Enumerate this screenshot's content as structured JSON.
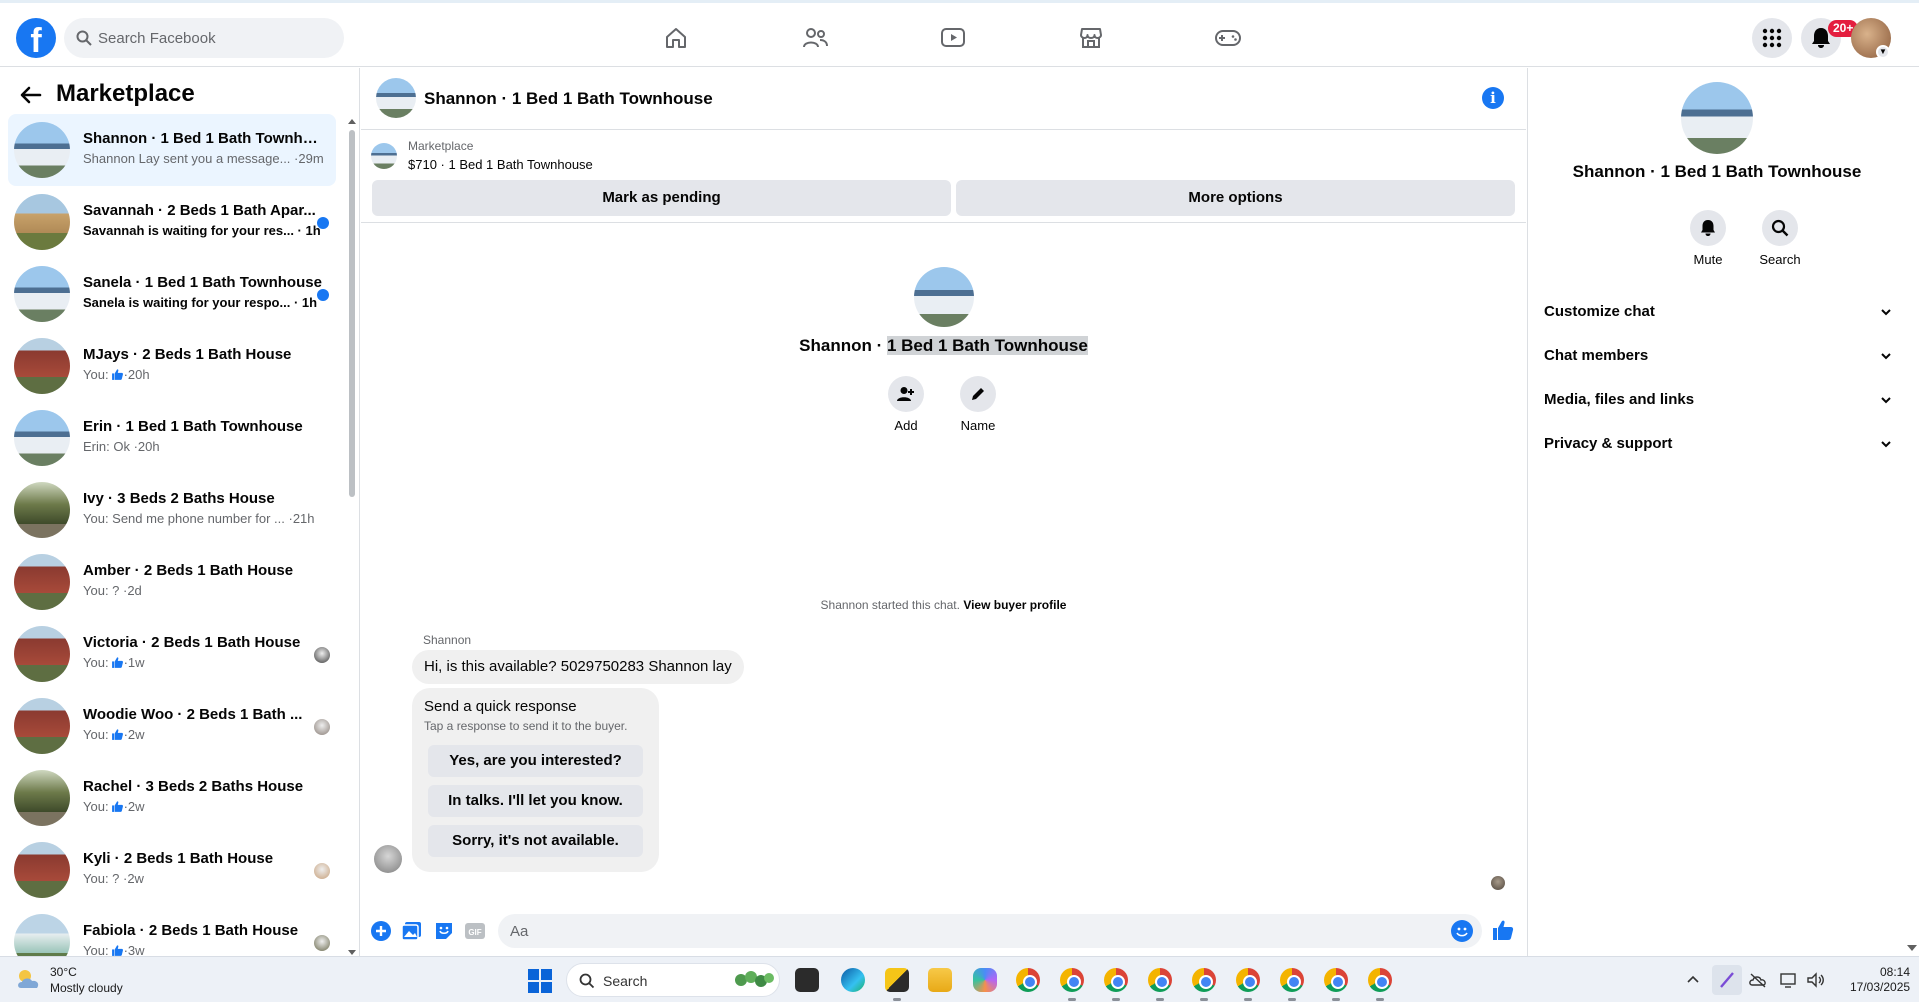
{
  "topnav": {
    "logo": "f",
    "search_placeholder": "Search Facebook",
    "notifications_badge": "20+"
  },
  "sidebar": {
    "title": "Marketplace",
    "conversations": [
      {
        "title": "Shannon · 1 Bed 1 Bath Townhou...",
        "subtitle": "Shannon Lay sent you a message... ·29m",
        "image": "house-blue",
        "active": true,
        "unread": false
      },
      {
        "title": "Savannah · 2 Beds 1 Bath Apar...",
        "subtitle": "Savannah is waiting for your res... · 1h",
        "image": "house-yellow",
        "active": false,
        "unread": true
      },
      {
        "title": "Sanela · 1 Bed 1 Bath Townhouse",
        "subtitle": "Sanela is waiting for your respo... · 1h",
        "image": "house-blue",
        "active": false,
        "unread": true
      },
      {
        "title": "MJays · 2 Beds 1 Bath House",
        "subtitle_prefix": "You:",
        "subtitle": "·20h",
        "like": true,
        "image": "house-red"
      },
      {
        "title": "Erin · 1 Bed 1 Bath Townhouse",
        "subtitle": "Erin: Ok ·20h",
        "image": "house-blue"
      },
      {
        "title": "Ivy · 3 Beds 2 Baths House",
        "subtitle": "You: Send me phone number for ... ·21h",
        "image": "house-tree"
      },
      {
        "title": "Amber · 2 Beds 1 Bath House",
        "subtitle": "You: ? ·2d",
        "image": "house-red"
      },
      {
        "title": "Victoria · 2 Beds 1 Bath House",
        "subtitle_prefix": "You:",
        "subtitle": "·1w",
        "like": true,
        "image": "house-red",
        "mini": "#3c3c3c"
      },
      {
        "title": "Woodie Woo · 2 Beds 1 Bath ...",
        "subtitle_prefix": "You:",
        "subtitle": "·2w",
        "like": true,
        "image": "house-red",
        "mini": "#8a7f78"
      },
      {
        "title": "Rachel · 3 Beds 2 Baths House",
        "subtitle_prefix": "You:",
        "subtitle": "·2w",
        "like": true,
        "image": "house-tree"
      },
      {
        "title": "Kyli · 2 Beds 1 Bath House",
        "subtitle": "You: ? ·2w",
        "image": "house-red",
        "mini": "#c7a07a"
      },
      {
        "title": "Fabiola · 2 Beds 1 Bath House",
        "subtitle_prefix": "You:",
        "subtitle": "·3w",
        "like": true,
        "image": "house-teal",
        "mini": "#6a6a4e"
      }
    ]
  },
  "chat": {
    "header_title": "Shannon · 1 Bed 1 Bath Townhouse",
    "listing_source": "Marketplace",
    "listing_price": "$710 · 1 Bed 1 Bath Townhouse",
    "mark_pending": "Mark as pending",
    "more_options": "More options",
    "intro_name_prefix": "Shannon · ",
    "intro_name_highlight": "1 Bed 1 Bath Townhouse",
    "add_label": "Add",
    "name_label": "Name",
    "started_text": "Shannon started this chat.",
    "view_profile": "View buyer profile",
    "sender": "Shannon",
    "message": "Hi, is this available? 5029750283 Shannon lay",
    "quick_title": "Send a quick response",
    "quick_sub": "Tap a response to send it to the buyer.",
    "quick_responses": [
      "Yes, are you interested?",
      "In talks. I'll let you know.",
      "Sorry, it's not available."
    ],
    "composer_placeholder": "Aa",
    "gif_label": "GIF"
  },
  "right_panel": {
    "title": "Shannon · 1 Bed 1 Bath Townhouse",
    "mute": "Mute",
    "search": "Search",
    "sections": [
      "Customize chat",
      "Chat members",
      "Media, files and links",
      "Privacy & support"
    ]
  },
  "taskbar": {
    "temperature": "30°C",
    "weather": "Mostly cloudy",
    "search_label": "Search",
    "time": "08:14",
    "date": "17/03/2025"
  },
  "colors": {
    "accent": "#1877f2",
    "badge": "#e41e3f",
    "active_row": "#ebf5ff"
  }
}
